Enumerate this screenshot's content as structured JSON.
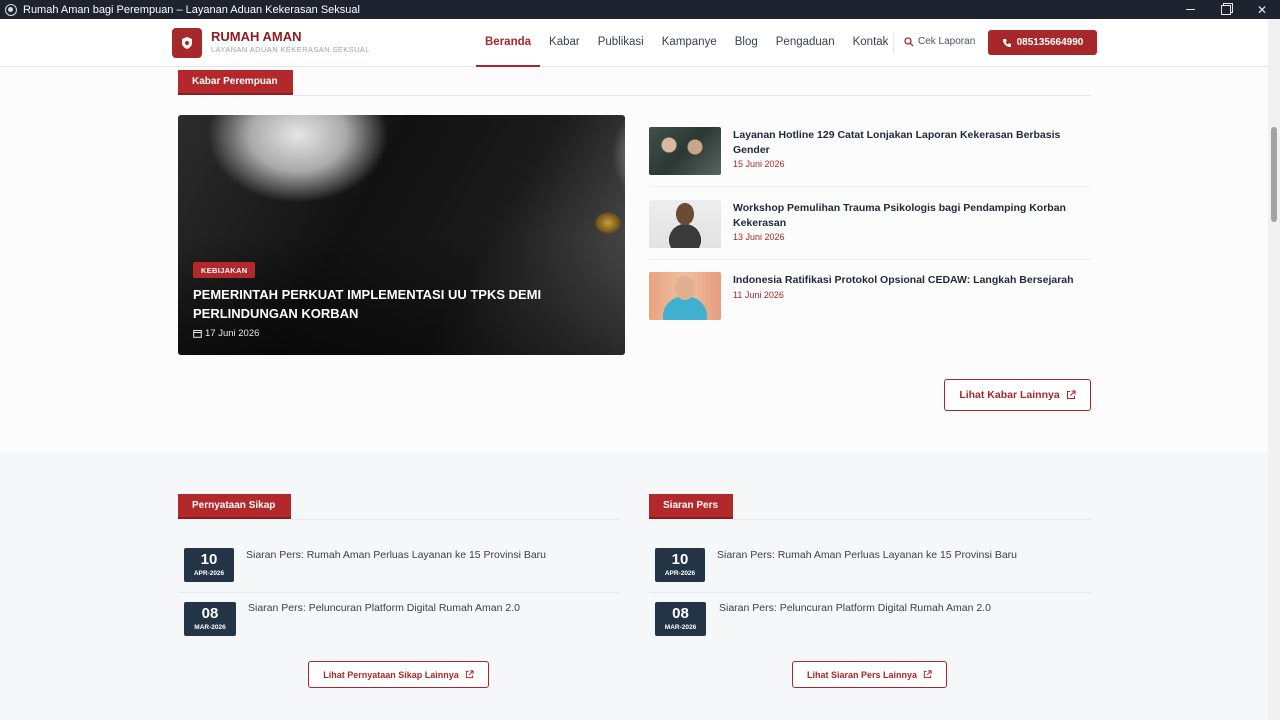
{
  "window": {
    "title": "Rumah Aman bagi Perempuan – Layanan Aduan Kekerasan Seksual"
  },
  "brand": {
    "name": "RUMAH AMAN",
    "tagline": "LAYANAN ADUAN KEKERASAN SEKSUAL"
  },
  "nav": {
    "items": [
      {
        "label": "Beranda",
        "active": true
      },
      {
        "label": "Kabar"
      },
      {
        "label": "Publikasi"
      },
      {
        "label": "Kampanye"
      },
      {
        "label": "Blog"
      },
      {
        "label": "Pengaduan"
      },
      {
        "label": "Kontak"
      }
    ],
    "cek_laporan": "Cek Laporan",
    "hotline": "085135664990"
  },
  "kabar": {
    "heading": "Kabar Perempuan",
    "featured": {
      "badge": "KEBIJAKAN",
      "title": "PEMERINTAH PERKUAT IMPLEMENTASI UU TPKS DEMI PERLINDUNGAN KORBAN",
      "date": "17 Juni 2026"
    },
    "items": [
      {
        "title": "Layanan Hotline 129 Catat Lonjakan Laporan Kekerasan Berbasis Gender",
        "date": "15 Juni 2026"
      },
      {
        "title": "Workshop Pemulihan Trauma Psikologis bagi Pendamping Korban Kekerasan",
        "date": "13 Juni 2026"
      },
      {
        "title": "Indonesia Ratifikasi Protokol Opsional CEDAW: Langkah Bersejarah",
        "date": "11 Juni 2026"
      }
    ],
    "more": "Lihat Kabar Lainnya"
  },
  "pernyataan": {
    "heading": "Pernyataan Sikap",
    "items": [
      {
        "day": "10",
        "month": "APR-2026",
        "title": "Siaran Pers: Rumah Aman Perluas Layanan ke 15 Provinsi Baru"
      },
      {
        "day": "08",
        "month": "MAR-2026",
        "title": "Siaran Pers: Peluncuran Platform Digital Rumah Aman 2.0"
      }
    ],
    "more": "Lihat Pernyataan Sikap Lainnya"
  },
  "siaran": {
    "heading": "Siaran Pers",
    "items": [
      {
        "day": "10",
        "month": "APR-2026",
        "title": "Siaran Pers: Rumah Aman Perluas Layanan ke 15 Provinsi Baru"
      },
      {
        "day": "08",
        "month": "MAR-2026",
        "title": "Siaran Pers: Peluncuran Platform Digital Rumah Aman 2.0"
      }
    ],
    "more": "Lihat Siaran Pers Lainnya"
  },
  "colors": {
    "brand": "#a7282a",
    "navy": "#243447"
  }
}
